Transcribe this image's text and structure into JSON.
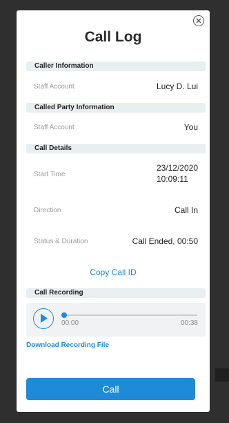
{
  "dialog": {
    "title": "Call Log",
    "close_icon": "close-circle-icon"
  },
  "caller_information": {
    "header": "Caller Information",
    "staff_account_label": "Staff Account",
    "staff_account_value": "Lucy D. Lui"
  },
  "called_party_information": {
    "header": "Called Party Information",
    "staff_account_label": "Staff Account",
    "staff_account_value": "You"
  },
  "call_details": {
    "header": "Call Details",
    "start_time_label": "Start Time",
    "start_time_date": "23/12/2020",
    "start_time_clock": "10:09:11",
    "direction_label": "Direction",
    "direction_value": "Call In",
    "status_label": "Status & Duration",
    "status_value": "Call Ended, 00:50"
  },
  "copy_call_id_link": "Copy Call ID",
  "call_recording": {
    "header": "Call Recording",
    "current_time": "00:00",
    "total_time": "00:38",
    "progress": 0,
    "play_icon": "play-icon",
    "download_link": "Download Recording File"
  },
  "call_button": "Call",
  "colors": {
    "accent": "#1f8ad8",
    "section_header_bg": "#e9eef0",
    "backdrop": "#2f2f2f"
  }
}
